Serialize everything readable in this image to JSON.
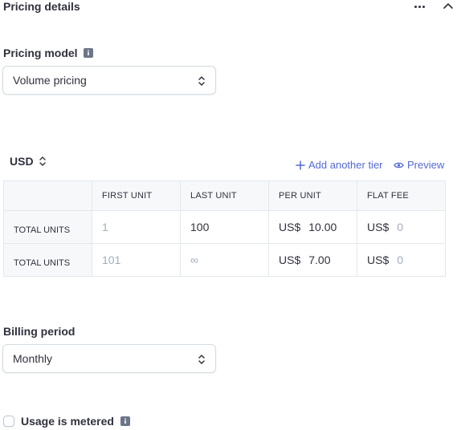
{
  "section": {
    "title": "Pricing details"
  },
  "pricing_model": {
    "label": "Pricing model",
    "value": "Volume pricing"
  },
  "currency": {
    "code": "USD"
  },
  "actions": {
    "add_tier": "Add another tier",
    "preview": "Preview"
  },
  "tiers_table": {
    "headers": [
      "FIRST UNIT",
      "LAST UNIT",
      "PER UNIT",
      "FLAT FEE"
    ],
    "rows": [
      {
        "label": "TOTAL UNITS",
        "first": "1",
        "last": "100",
        "per_unit_currency": "US$",
        "per_unit": "10.00",
        "flat_fee_currency": "US$",
        "flat_fee": "0"
      },
      {
        "label": "TOTAL UNITS",
        "first": "101",
        "last": "∞",
        "per_unit_currency": "US$",
        "per_unit": "7.00",
        "flat_fee_currency": "US$",
        "flat_fee": "0"
      }
    ]
  },
  "billing_period": {
    "label": "Billing period",
    "value": "Monthly"
  },
  "metered": {
    "label": "Usage is metered",
    "checked": false
  },
  "colors": {
    "link": "#5469d4",
    "text": "#30313d",
    "muted": "#a3acb9",
    "border": "#e3e8ee"
  },
  "icons": [
    "more-icon",
    "chevron-up-icon",
    "info-icon",
    "chevron-updown-icon",
    "plus-icon",
    "eye-icon"
  ]
}
